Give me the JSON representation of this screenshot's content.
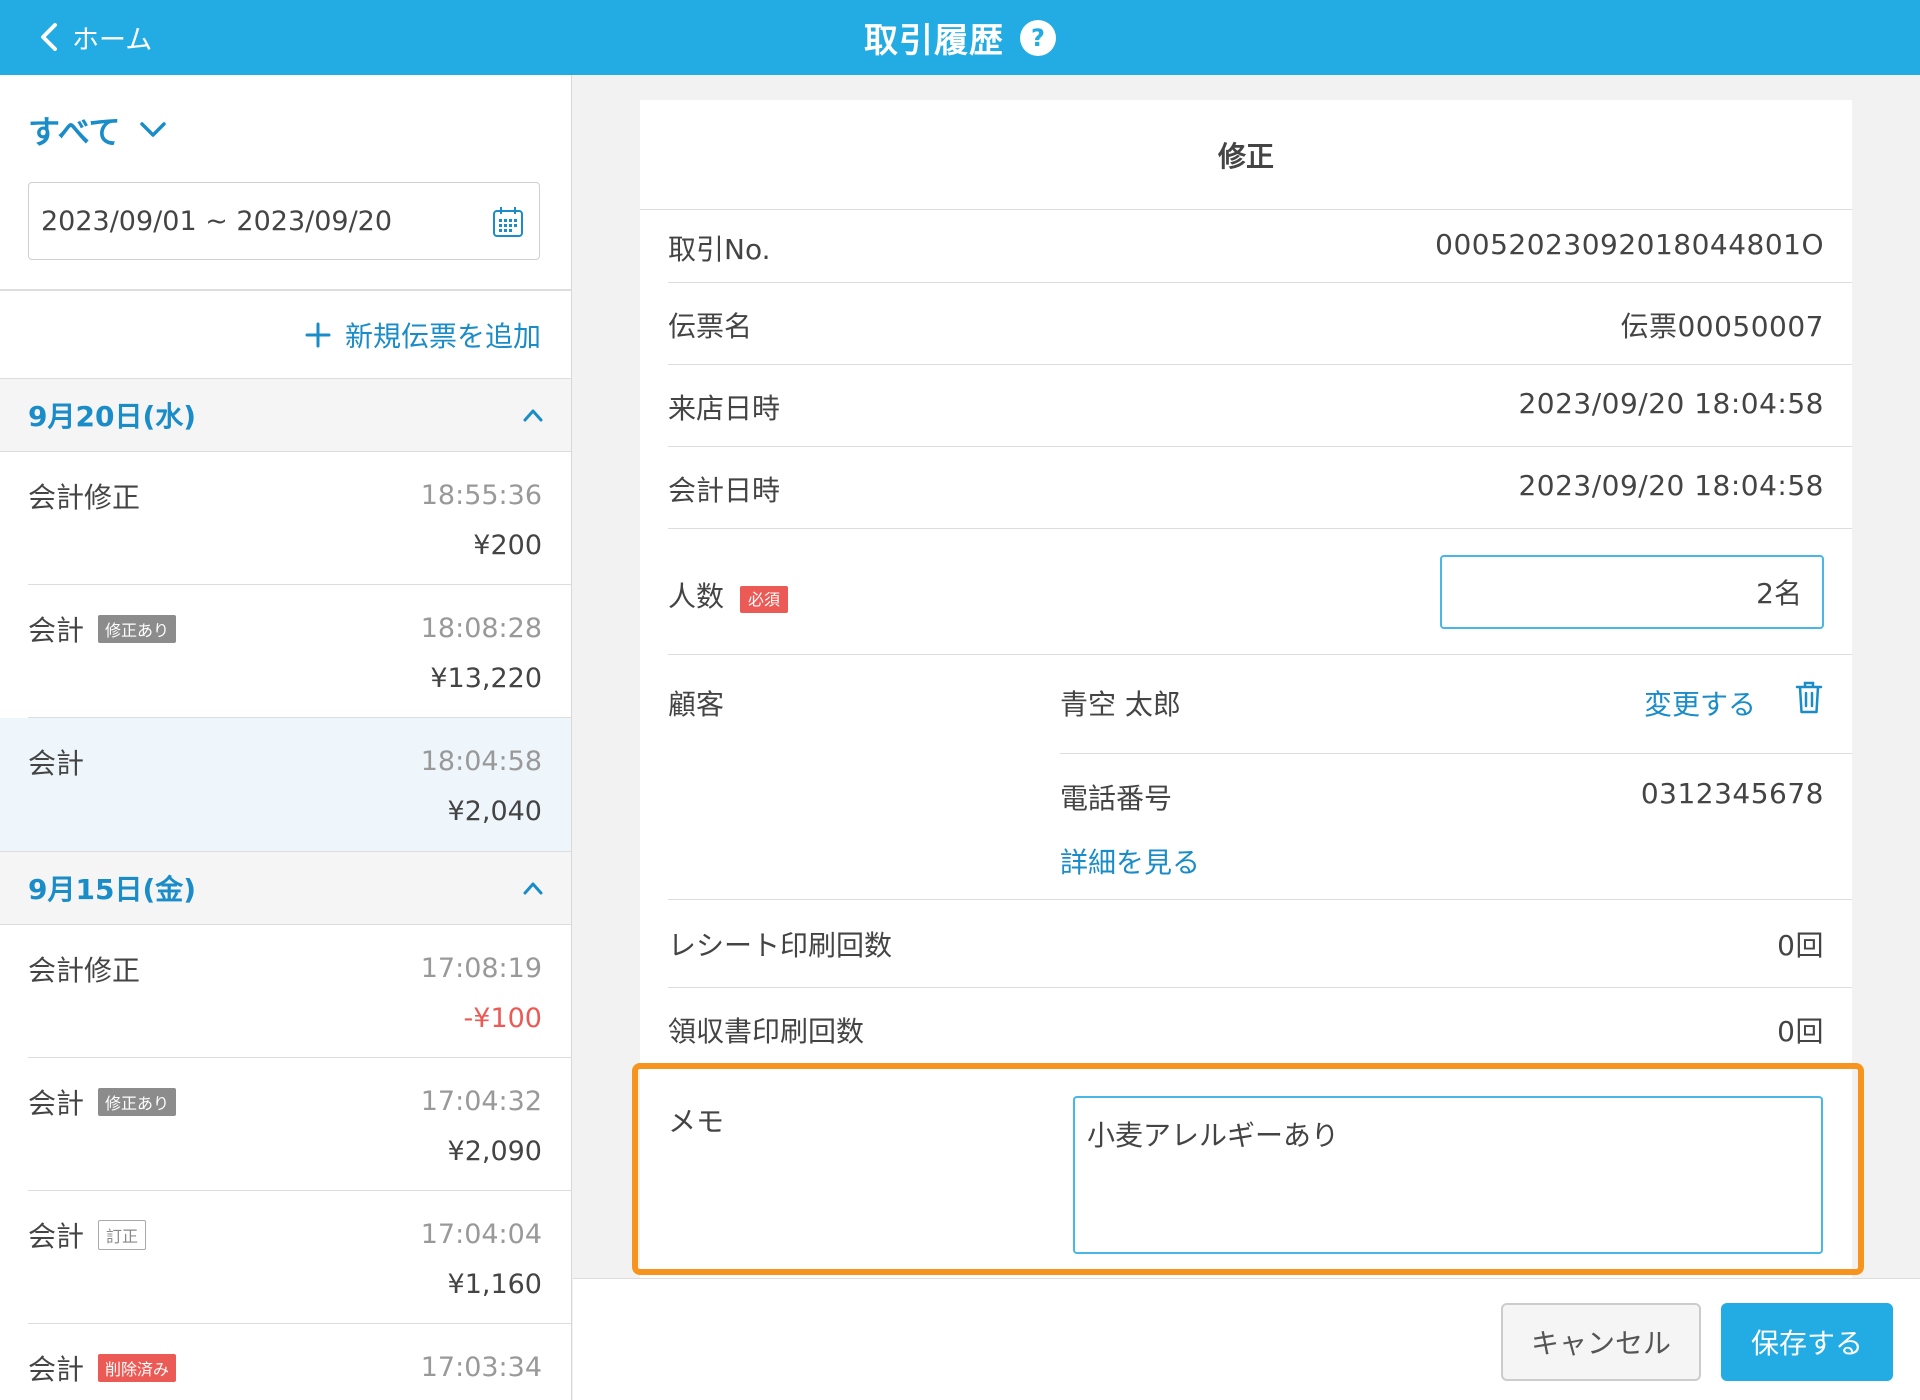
{
  "header": {
    "back_label": "ホーム",
    "title": "取引履歴",
    "help_symbol": "?"
  },
  "sidebar": {
    "filter_label": "すべて",
    "date_range": "2023/09/01 ~ 2023/09/20",
    "add_slip_label": "新規伝票を追加",
    "groups": [
      {
        "date": "9月20日(水)",
        "items": [
          {
            "type": "会計修正",
            "badge": "",
            "time": "18:55:36",
            "amount": "¥200"
          },
          {
            "type": "会計",
            "badge": "修正あり",
            "time": "18:08:28",
            "amount": "¥13,220"
          },
          {
            "type": "会計",
            "badge": "",
            "time": "18:04:58",
            "amount": "¥2,040"
          }
        ]
      },
      {
        "date": "9月15日(金)",
        "items": [
          {
            "type": "会計修正",
            "badge": "",
            "time": "17:08:19",
            "amount": "-¥100"
          },
          {
            "type": "会計",
            "badge": "修正あり",
            "time": "17:04:32",
            "amount": "¥2,090"
          },
          {
            "type": "会計",
            "badge": "訂正",
            "time": "17:04:04",
            "amount": "¥1,160"
          },
          {
            "type": "会計",
            "badge": "削除済み",
            "time": "17:03:34",
            "amount": ""
          }
        ]
      }
    ]
  },
  "detail": {
    "title": "修正",
    "txn_no_label": "取引No.",
    "txn_no": "00052023092018044801O",
    "slip_name_label": "伝票名",
    "slip_name": "伝票00050007",
    "visit_label": "来店日時",
    "visit_datetime": "2023/09/20 18:04:58",
    "checkout_label": "会計日時",
    "checkout_datetime": "2023/09/20 18:04:58",
    "people_label": "人数",
    "required_badge": "必須",
    "people_value": "2名",
    "customer_label": "顧客",
    "customer_name": "青空 太郎",
    "change_label": "変更する",
    "phone_label": "電話番号",
    "phone_value": "0312345678",
    "detail_link": "詳細を見る",
    "receipt_print_label": "レシート印刷回数",
    "receipt_print_count": "0回",
    "invoice_print_label": "領収書印刷回数",
    "invoice_print_count": "0回",
    "memo_label": "メモ",
    "memo_value": "小麦アレルギーあり"
  },
  "footer": {
    "cancel_label": "キャンセル",
    "save_label": "保存する"
  },
  "colors": {
    "header_bg": "#22ace3",
    "link": "#1a8cc8",
    "highlight": "#f7941d",
    "required": "#ec5a55"
  }
}
